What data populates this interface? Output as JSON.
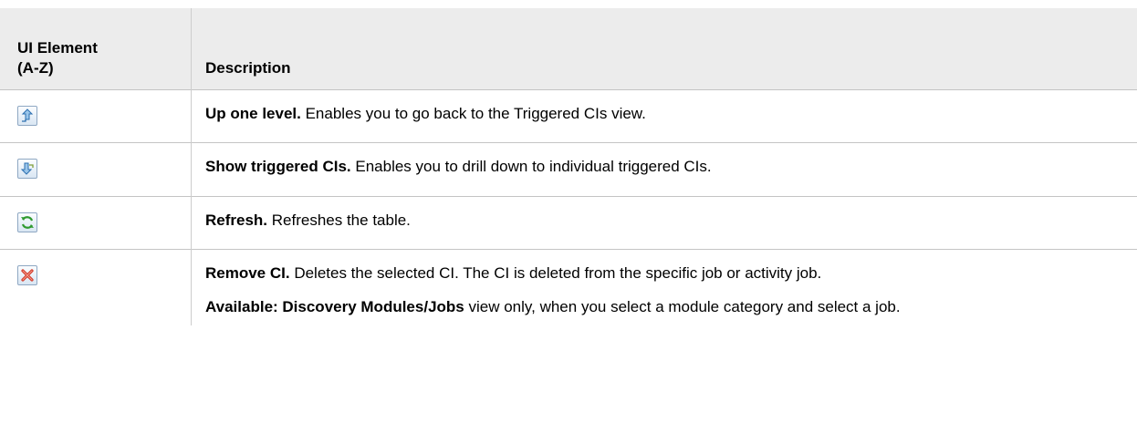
{
  "header": {
    "col1_line1": "UI Element",
    "col1_line2": "(A-Z)",
    "col2": "Description"
  },
  "rows": [
    {
      "icon": "up-one-level-icon",
      "title": "Up one level.",
      "text": " Enables you to go back to the Triggered CIs view."
    },
    {
      "icon": "show-triggered-cis-icon",
      "title": "Show triggered CIs.",
      "text": " Enables you to drill down to individual triggered CIs."
    },
    {
      "icon": "refresh-icon",
      "title": "Refresh.",
      "text": " Refreshes the table."
    },
    {
      "icon": "remove-ci-icon",
      "title": "Remove CI.",
      "text": " Deletes the selected CI. The CI is deleted from the specific job or activity job.",
      "note_title": "Available: Discovery Modules/Jobs",
      "note_text": " view only, when you select a module category and select a job."
    }
  ]
}
